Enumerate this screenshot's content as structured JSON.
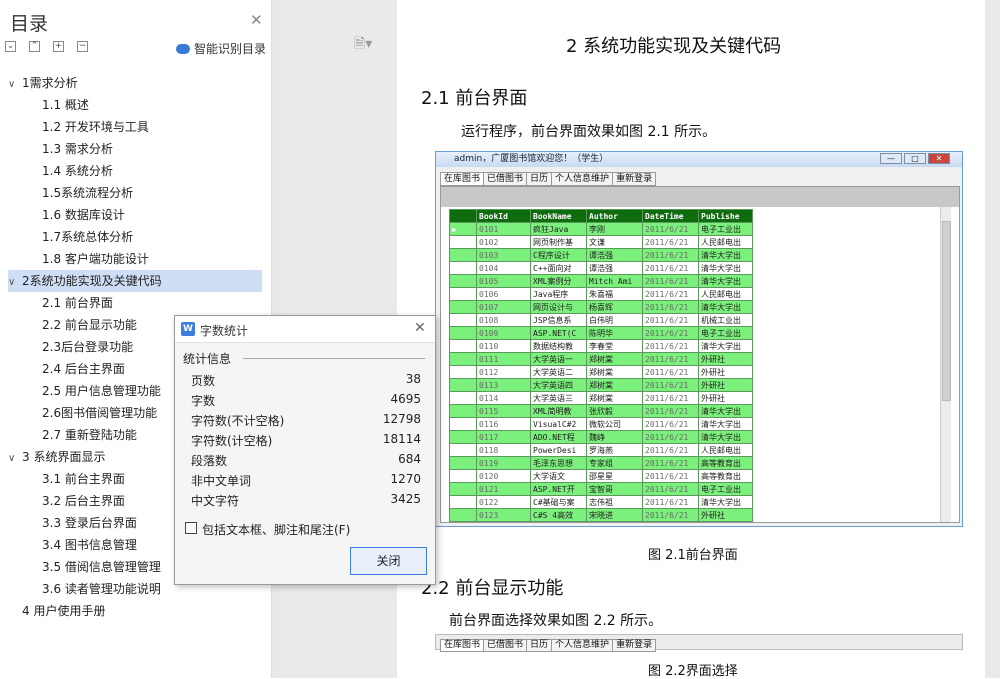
{
  "nav": {
    "title": "目录",
    "smart_label": "智能识别目录",
    "items": [
      {
        "text": "1需求分析",
        "level": 0,
        "expand": true
      },
      {
        "text": "1.1  概述",
        "level": 1
      },
      {
        "text": "1.2  开发环境与工具",
        "level": 1
      },
      {
        "text": "1.3  需求分析",
        "level": 1
      },
      {
        "text": "1.4  系统分析",
        "level": 1
      },
      {
        "text": "1.5系统流程分析",
        "level": 1
      },
      {
        "text": "1.6  数据库设计",
        "level": 1
      },
      {
        "text": "1.7系统总体分析",
        "level": 1
      },
      {
        "text": "1.8  客户端功能设计",
        "level": 1
      },
      {
        "text": "2系统功能实现及关键代码",
        "level": 0,
        "expand": true,
        "selected": true
      },
      {
        "text": "2.1  前台界面",
        "level": 1
      },
      {
        "text": "2.2  前台显示功能",
        "level": 1
      },
      {
        "text": "2.3后台登录功能",
        "level": 1
      },
      {
        "text": "2.4  后台主界面",
        "level": 1
      },
      {
        "text": "2.5  用户信息管理功能",
        "level": 1
      },
      {
        "text": "2.6图书借阅管理功能",
        "level": 1
      },
      {
        "text": "2.7  重新登陆功能",
        "level": 1
      },
      {
        "text": "3 系统界面显示",
        "level": 0,
        "expand": true
      },
      {
        "text": "3.1  前台主界面",
        "level": 1
      },
      {
        "text": "3.2  后台主界面",
        "level": 1
      },
      {
        "text": "3.3 登录后台界面",
        "level": 1
      },
      {
        "text": "3.4 图书信息管理",
        "level": 1
      },
      {
        "text": "3.5 借阅信息管理管理",
        "level": 1
      },
      {
        "text": "3.6 读者管理功能说明",
        "level": 1
      },
      {
        "text": "4 用户使用手册",
        "level": 0
      }
    ]
  },
  "doc": {
    "h1": "2   系统功能实现及关键代码",
    "h2a": "2.1  前台界面",
    "para1": "运行程序，前台界面效果如图 2.1 所示。",
    "cap1": "图 2.1前台界面",
    "h2b": "2.2  前台显示功能",
    "para2": "前台界面选择效果如图 2.2 所示。",
    "cap2": "图 2.2界面选择"
  },
  "app": {
    "title": "admin，广厦图书馆欢迎您！（学生）",
    "tabs": [
      "在库图书",
      "已借图书",
      "日历",
      "个人信息维护",
      "重新登录"
    ],
    "columns": [
      "BookId",
      "BookName",
      "Author",
      "DateTime",
      "Publishe"
    ],
    "rows": [
      [
        "0101",
        "疯狂Java",
        "李刚",
        "2011/6/21",
        "电子工业出"
      ],
      [
        "0102",
        "网页制作基",
        "文谦",
        "2011/6/21",
        "人民邮电出"
      ],
      [
        "0103",
        "C程序设计",
        "谭浩强",
        "2011/6/21",
        "清华大学出"
      ],
      [
        "0104",
        "C++面向对",
        "谭浩强",
        "2011/6/21",
        "清华大学出"
      ],
      [
        "0105",
        "XML案例分",
        "Mitch Ami",
        "2011/6/21",
        "清华大学出"
      ],
      [
        "0106",
        "Java程序",
        "朱喜福",
        "2011/6/21",
        "人民邮电出"
      ],
      [
        "0107",
        "网页设计与",
        "杨喜辉",
        "2011/6/21",
        "清华大学出"
      ],
      [
        "0108",
        "JSP信息系",
        "白伟明",
        "2011/6/21",
        "机械工业出"
      ],
      [
        "0109",
        "ASP.NET(C",
        "陈明华",
        "2011/6/21",
        "电子工业出"
      ],
      [
        "0110",
        "数据结构教",
        "李春堂",
        "2011/6/21",
        "清华大学出"
      ],
      [
        "0111",
        "大学英语一",
        "郑树棠",
        "2011/6/21",
        "外研社"
      ],
      [
        "0112",
        "大学英语二",
        "郑树棠",
        "2011/6/21",
        "外研社"
      ],
      [
        "0113",
        "大学英语四",
        "郑树棠",
        "2011/6/21",
        "外研社"
      ],
      [
        "0114",
        "大学英语三",
        "郑树棠",
        "2011/6/21",
        "外研社"
      ],
      [
        "0115",
        "XML简明教",
        "张欣毅",
        "2011/6/21",
        "清华大学出"
      ],
      [
        "0116",
        "VisualC#2",
        "微软公司",
        "2011/6/21",
        "清华大学出"
      ],
      [
        "0117",
        "ADO.NET程",
        "魏峥",
        "2011/6/21",
        "清华大学出"
      ],
      [
        "0118",
        "PowerDesi",
        "罗海燕",
        "2011/6/21",
        "人民邮电出"
      ],
      [
        "0119",
        "毛泽东思想",
        "专家组",
        "2011/6/21",
        "高等教育出"
      ],
      [
        "0120",
        "大学语文",
        "邵星星",
        "2011/6/21",
        "高等教育出"
      ],
      [
        "0121",
        "ASP.NET开",
        "宝智哥",
        "2011/6/21",
        "电子工业出"
      ],
      [
        "0122",
        "C#基础与案",
        "志伟祖",
        "2011/6/21",
        "清华大学出"
      ],
      [
        "0123",
        "C#S 4高效",
        "宋晓进",
        "2011/6/21",
        "外研社"
      ]
    ]
  },
  "dialog": {
    "title": "字数统计",
    "section": "统计信息",
    "stats": [
      {
        "label": "页数",
        "value": "38"
      },
      {
        "label": "字数",
        "value": "4695"
      },
      {
        "label": "字符数(不计空格)",
        "value": "12798"
      },
      {
        "label": "字符数(计空格)",
        "value": "18114"
      },
      {
        "label": "段落数",
        "value": "684"
      },
      {
        "label": "非中文单词",
        "value": "1270"
      },
      {
        "label": "中文字符",
        "value": "3425"
      }
    ],
    "checkbox": "包括文本框、脚注和尾注(F)",
    "close": "关闭"
  }
}
